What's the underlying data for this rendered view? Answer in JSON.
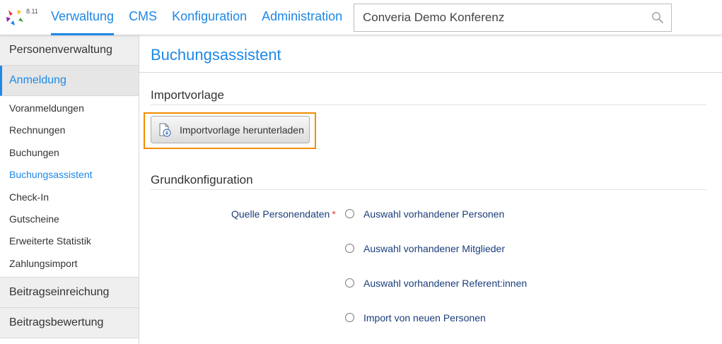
{
  "app": {
    "version": "8.11",
    "logo_colors": [
      "#e53935",
      "#fbc02d",
      "#43a047",
      "#1e88e5",
      "#8e24aa"
    ]
  },
  "topnav": {
    "items": [
      {
        "label": "Verwaltung",
        "active": true
      },
      {
        "label": "CMS",
        "active": false
      },
      {
        "label": "Konfiguration",
        "active": false
      },
      {
        "label": "Administration",
        "active": false
      }
    ]
  },
  "search": {
    "value": "Converia Demo Konferenz",
    "icon": "search-icon"
  },
  "sidebar": {
    "sections": [
      {
        "label": "Personenverwaltung"
      },
      {
        "label": "Anmeldung",
        "active": true
      },
      {
        "label": "Beitragseinreichung"
      },
      {
        "label": "Beitragsbewertung"
      }
    ],
    "anmeldung_items": [
      {
        "label": "Voranmeldungen"
      },
      {
        "label": "Rechnungen"
      },
      {
        "label": "Buchungen"
      },
      {
        "label": "Buchungsassistent",
        "active": true
      },
      {
        "label": "Check-In"
      },
      {
        "label": "Gutscheine"
      },
      {
        "label": "Erweiterte Statistik"
      },
      {
        "label": "Zahlungsimport"
      }
    ]
  },
  "main": {
    "page_title": "Buchungsassistent",
    "import_section": {
      "title": "Importvorlage",
      "download_button": {
        "label": "Importvorlage herunterladen",
        "icon": "document-download-icon"
      }
    },
    "config_section": {
      "title": "Grundkonfiguration",
      "field_label": "Quelle Personendaten",
      "required_marker": "*",
      "options": [
        {
          "label": "Auswahl vorhandener Personen",
          "selected": false
        },
        {
          "label": "Auswahl vorhandener Mitglieder",
          "selected": false
        },
        {
          "label": "Auswahl vorhandener Referent:innen",
          "selected": false
        },
        {
          "label": "Import von neuen Personen",
          "selected": false
        }
      ]
    }
  },
  "colors": {
    "accent": "#1e88e5",
    "highlight": "#f28c00",
    "required": "#e53935",
    "label_text": "#1a3e7a"
  }
}
